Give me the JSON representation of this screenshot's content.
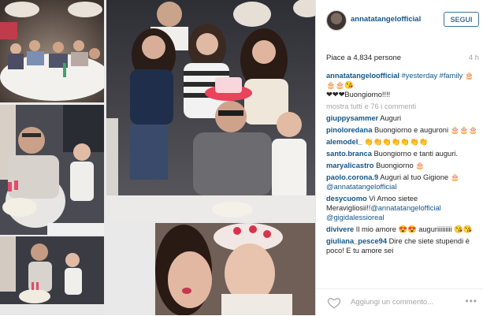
{
  "post": {
    "username": "annatatangelofficial",
    "follow_label": "SEGUI",
    "likes": "Piace a 4,834 persone",
    "time": "4 h",
    "photo_labels": [
      "dinner-table-photo",
      "man-and-child-cake-photo",
      "family-group-photo",
      "man-and-child-cake-photo-2",
      "woman-and-child-selfie-photo"
    ]
  },
  "comments": [
    {
      "user": "annatatangeloofficial",
      "text_parts": [
        {
          "t": "#yesterday",
          "tag": true
        },
        {
          "t": " ",
          "tag": false
        },
        {
          "t": "#family",
          "tag": true
        },
        {
          "t": " 🎂🎂🎂😘",
          "tag": false
        },
        {
          "t": "\n❤❤❤Buongiorno!!!!",
          "tag": false
        }
      ]
    },
    {
      "more": "mostra tutti e 76 i commenti"
    },
    {
      "user": "giuppysammer",
      "text_parts": [
        {
          "t": "Auguri",
          "tag": false
        }
      ]
    },
    {
      "user": "pinoloredana",
      "text_parts": [
        {
          "t": "Buongiorno e auguroni 🎂🎂🎂",
          "tag": false
        }
      ]
    },
    {
      "user": "alemodel_",
      "text_parts": [
        {
          "t": "👏👏👏👏👏👏👏",
          "tag": false
        }
      ]
    },
    {
      "user": "santo.branca",
      "text_parts": [
        {
          "t": "Buongiorno e tanti auguri.",
          "tag": false
        }
      ]
    },
    {
      "user": "maryalicastro",
      "text_parts": [
        {
          "t": "Buongiorno 🎂",
          "tag": false
        }
      ]
    },
    {
      "user": "paolo.corona.9",
      "text_parts": [
        {
          "t": "Auguri al tuo Gigione 🎂 ",
          "tag": false
        },
        {
          "t": "@annatatangelofficial",
          "tag": true
        }
      ]
    },
    {
      "user": "desycuomo",
      "text_parts": [
        {
          "t": "Vi Amoo sietee Meravigliosii!!",
          "tag": false
        },
        {
          "t": "@annatatangelofficial",
          "tag": true
        },
        {
          "t": " ",
          "tag": false
        },
        {
          "t": "@gigidalessioreal",
          "tag": true
        }
      ]
    },
    {
      "user": "divivere",
      "text_parts": [
        {
          "t": "Il mio amore 😍😍 auguriiiiiiiii 😘😘",
          "tag": false
        }
      ]
    },
    {
      "user": "giuliana_pesce94",
      "text_parts": [
        {
          "t": "Dire che siete stupendi è poco! E tu amore sei",
          "tag": false
        }
      ]
    }
  ],
  "footer": {
    "add_comment_placeholder": "Aggiungi un commento...",
    "more_label": "•••"
  },
  "colors": {
    "link": "#125688",
    "accent": "#3f729b",
    "muted": "#a5a5a5"
  }
}
